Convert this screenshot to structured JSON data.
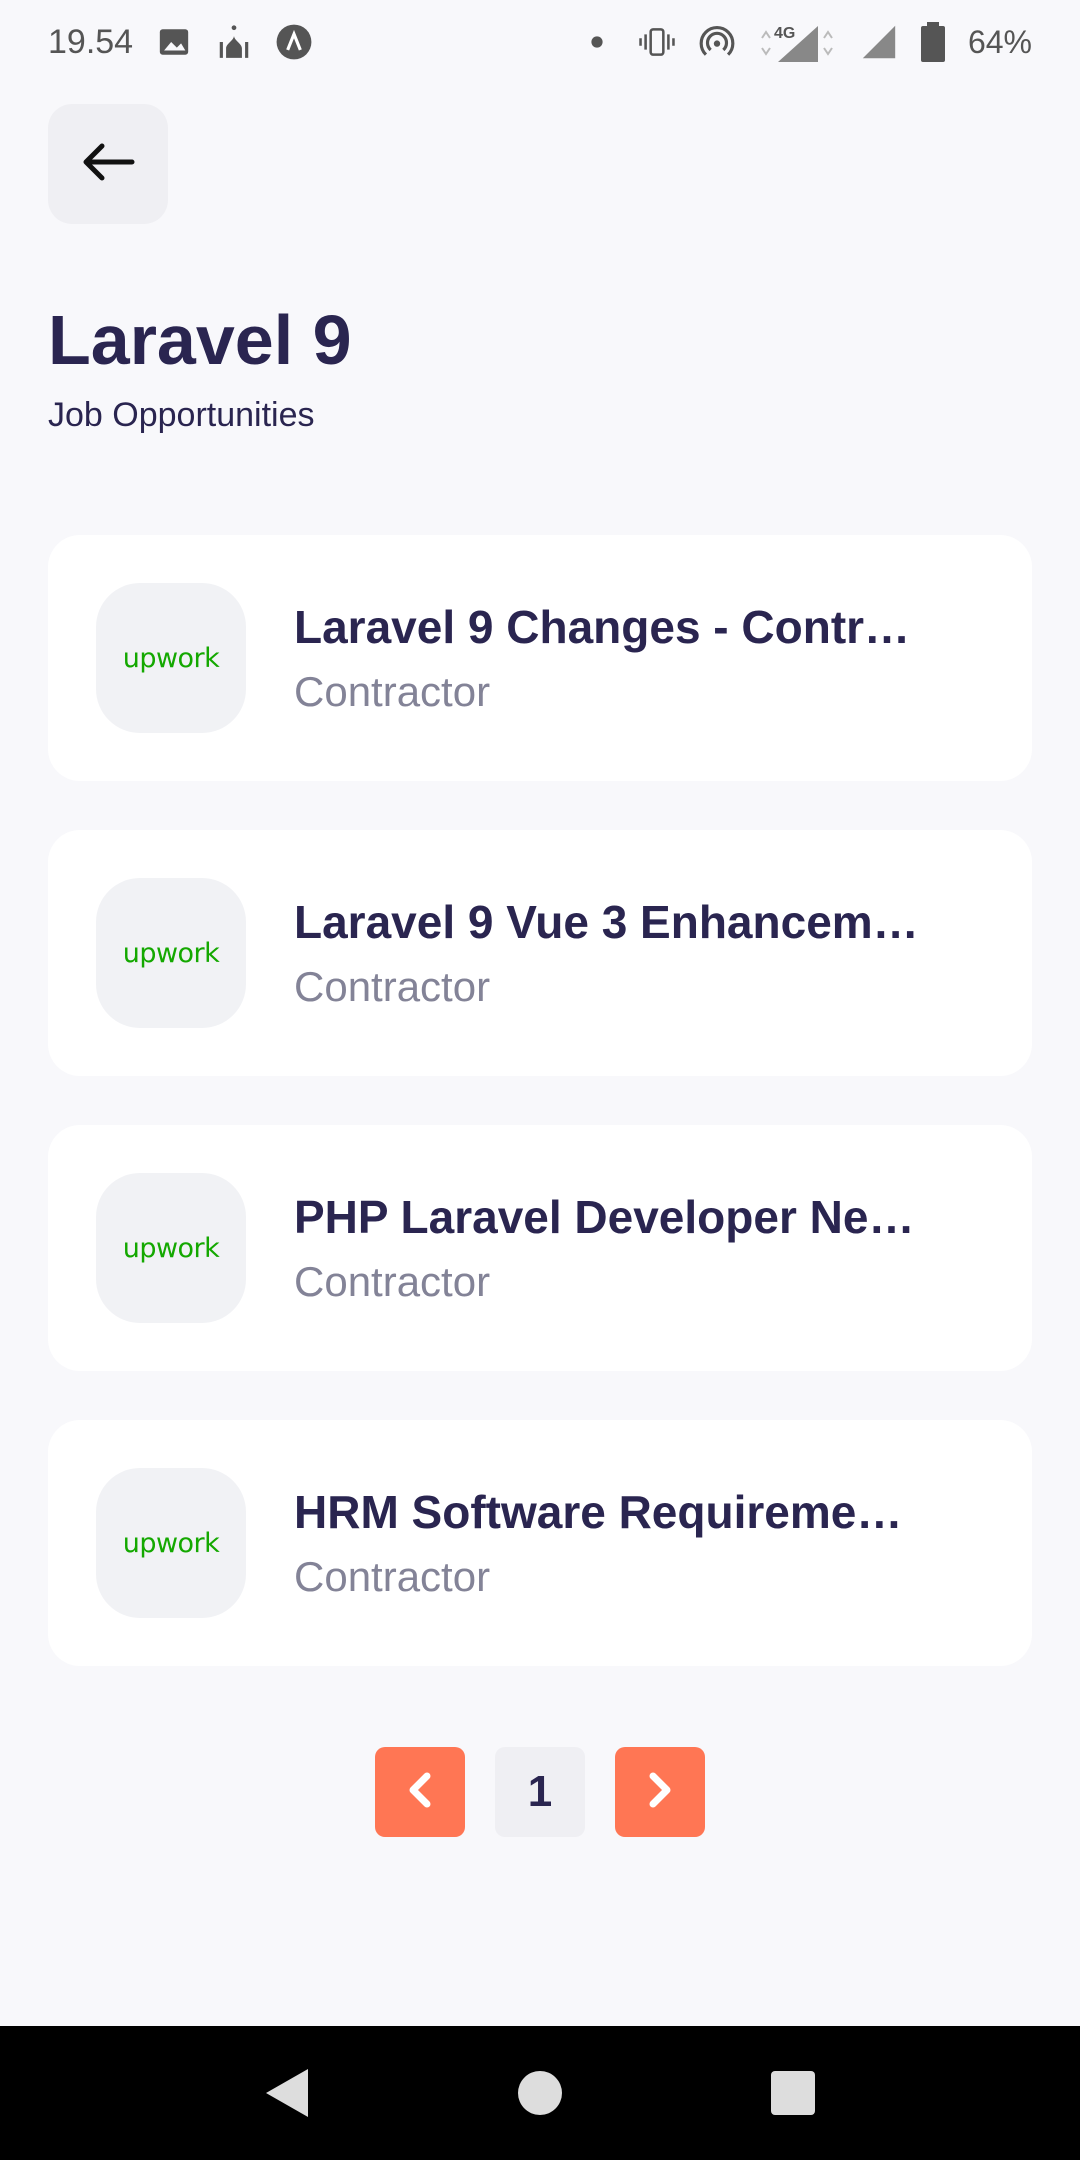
{
  "status_bar": {
    "time": "19.54",
    "battery": "64%",
    "network": "4G",
    "icons": [
      "image-icon",
      "mosque-icon",
      "app-a-icon",
      "dot-icon",
      "vibrate-icon",
      "hotspot-icon",
      "signal-4g-icon",
      "signal-icon",
      "battery-icon"
    ]
  },
  "header": {
    "back_icon": "arrow-left-icon",
    "title": "Laravel 9",
    "subtitle": "Job Opportunities"
  },
  "jobs": [
    {
      "logo": "upwork",
      "title": "Laravel 9 Changes - Contr…",
      "type": "Contractor"
    },
    {
      "logo": "upwork",
      "title": "Laravel 9 Vue 3 Enhancem…",
      "type": "Contractor"
    },
    {
      "logo": "upwork",
      "title": "PHP Laravel Developer Ne…",
      "type": "Contractor"
    },
    {
      "logo": "upwork",
      "title": "HRM Software Requireme…",
      "type": "Contractor"
    }
  ],
  "pagination": {
    "current_page": "1",
    "prev_icon": "chevron-left-icon",
    "next_icon": "chevron-right-icon"
  },
  "colors": {
    "accent": "#ff7654",
    "title": "#2a2550",
    "muted": "#838397",
    "upwork_green": "#14a800",
    "background": "#f8f8fb"
  },
  "nav": {
    "icons": [
      "back-triangle-icon",
      "home-circle-icon",
      "recents-square-icon"
    ]
  }
}
